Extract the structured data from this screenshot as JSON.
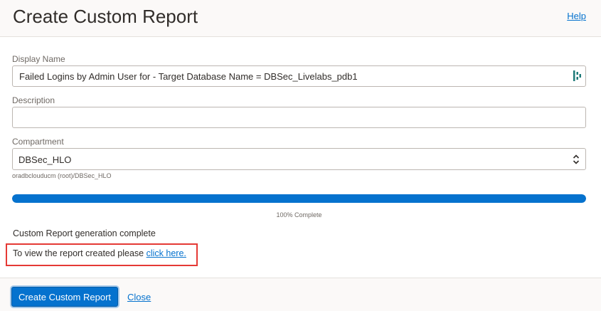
{
  "dialog": {
    "title": "Create Custom Report",
    "help_label": "Help"
  },
  "form": {
    "display_name": {
      "label": "Display Name",
      "value": "Failed Logins by Admin User for - Target Database Name = DBSec_Livelabs_pdb1",
      "icon": "fill-icon"
    },
    "description": {
      "label": "Description",
      "value": ""
    },
    "compartment": {
      "label": "Compartment",
      "selected": "DBSec_HLO",
      "path": "oradbclouducm (root)/DBSec_HLO",
      "icon": "chevron-updown-icon"
    }
  },
  "progress": {
    "percent": 100,
    "label": "100% Complete"
  },
  "status": {
    "message": "Custom Report generation complete",
    "view_prefix": "To view the report created please",
    "view_link": "click here."
  },
  "footer": {
    "primary_label": "Create Custom Report",
    "close_label": "Close"
  },
  "colors": {
    "accent": "#0572ce",
    "highlight": "#e53935",
    "icon_teal": "#1e7a78"
  }
}
